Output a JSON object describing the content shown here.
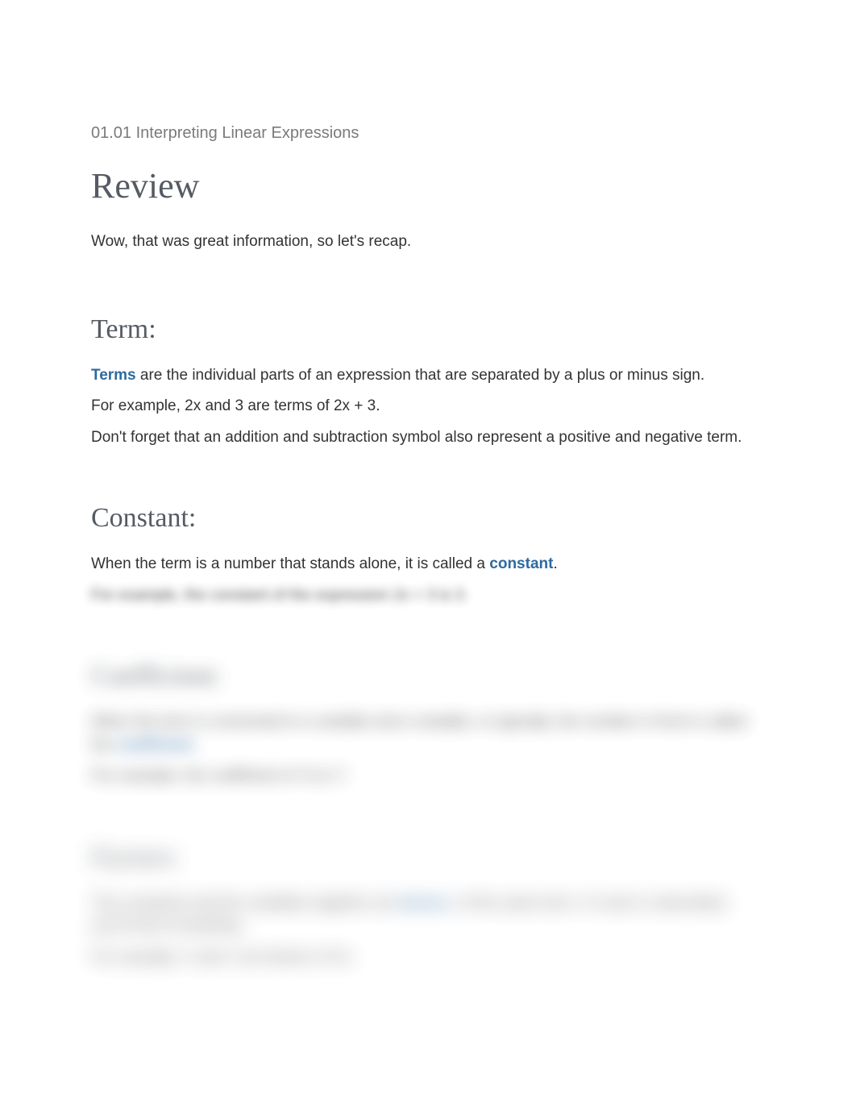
{
  "breadcrumb": "01.01 Interpreting Linear Expressions",
  "heading_review": "Review",
  "intro": "Wow, that was great information, so let's recap.",
  "term": {
    "heading": "Term:",
    "key": "Terms",
    "def_rest": " are the individual parts of an expression that are separated by a plus or minus sign.",
    "example": "For example, 2x and 3 are terms of 2x + 3.",
    "note": "Don't forget that an addition and subtraction symbol also represent a positive and negative term."
  },
  "constant": {
    "heading": "Constant:",
    "def_before": "When the term is a number that stands alone, it is called a ",
    "key": "constant",
    "def_after": ".",
    "example": "For example, the constant of the expression 2x + 3 is 3."
  },
  "coefficient": {
    "heading": "Coefficient:",
    "def_before": "When the term is connected to a variable and a variable, or typically, the number in front is called the ",
    "key": "coefficient",
    "def_after": ".",
    "example": "For example, the coefficient of 7a is 7."
  },
  "factors": {
    "heading": "Factors:",
    "def_before": "The constants and the variables together are ",
    "key": "factors",
    "def_after": ", of the same term. If a term is described, you'll know everything.",
    "example": "For example, 4 and n are factors of 4n."
  }
}
